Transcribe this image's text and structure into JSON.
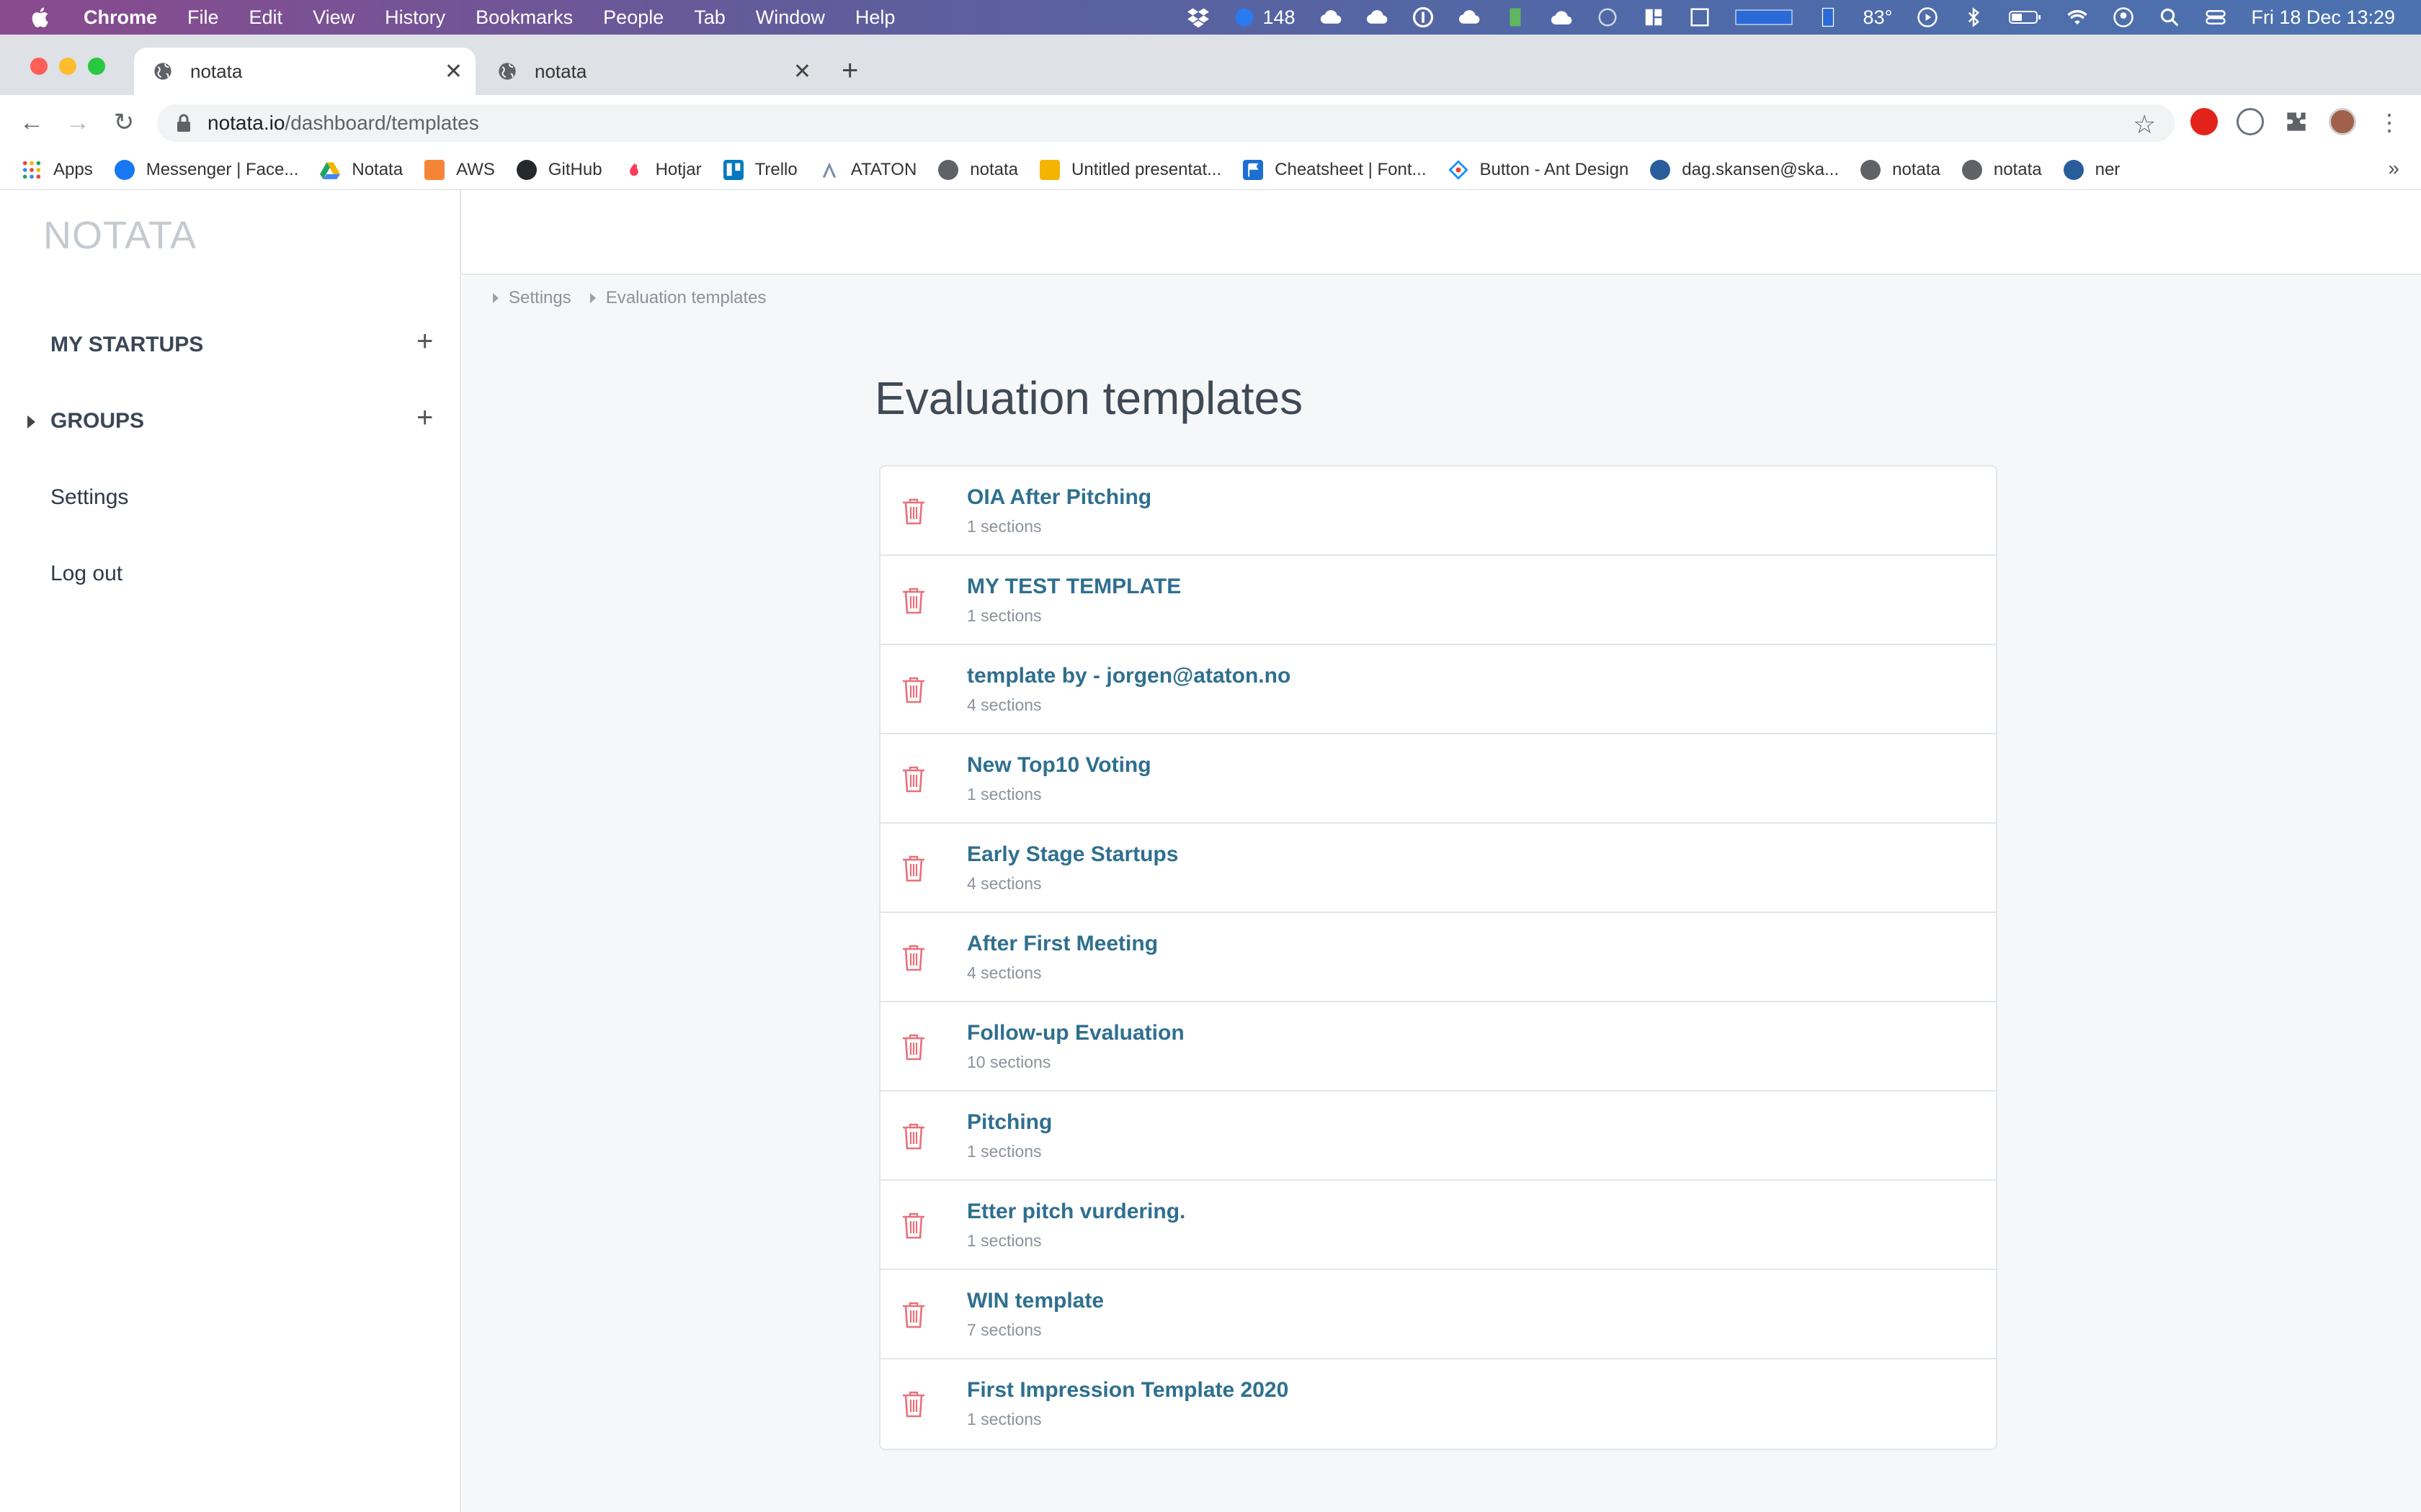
{
  "menubar": {
    "app": "Chrome",
    "items": [
      "File",
      "Edit",
      "View",
      "History",
      "Bookmarks",
      "People",
      "Tab",
      "Window",
      "Help"
    ],
    "badge_count": "148",
    "temperature": "83°",
    "datetime": "Fri 18 Dec  13:29"
  },
  "tabs": [
    {
      "title": "notata"
    },
    {
      "title": "notata"
    }
  ],
  "omnibox": {
    "host": "notata.io",
    "path": "/dashboard/templates"
  },
  "bookmarks": [
    {
      "label": "Apps",
      "icon": "apps-grid-icon",
      "color": "#e8453c"
    },
    {
      "label": "Messenger | Face...",
      "icon": "facebook-icon",
      "color": "#1877f2"
    },
    {
      "label": "Notata",
      "icon": "drive-icon",
      "color": "#1fa463"
    },
    {
      "label": "AWS",
      "icon": "aws-cube-icon",
      "color": "#f58536"
    },
    {
      "label": "GitHub",
      "icon": "github-icon",
      "color": "#24292e"
    },
    {
      "label": "Hotjar",
      "icon": "hotjar-flame-icon",
      "color": "#fd3a5c"
    },
    {
      "label": "Trello",
      "icon": "trello-icon",
      "color": "#0079bf"
    },
    {
      "label": "ATATON",
      "icon": "ataton-icon",
      "color": "#7a8ca5"
    },
    {
      "label": "notata",
      "icon": "globe-icon",
      "color": "#5f6368"
    },
    {
      "label": "Untitled presentat...",
      "icon": "slides-icon",
      "color": "#f4b400"
    },
    {
      "label": "Cheatsheet | Font...",
      "icon": "flag-icon",
      "color": "#1c6fd1"
    },
    {
      "label": "Button - Ant Design",
      "icon": "ant-design-icon",
      "color": "#f04134"
    },
    {
      "label": "dag.skansen@ska...",
      "icon": "database-icon",
      "color": "#2a5d9c"
    },
    {
      "label": "notata",
      "icon": "globe-icon",
      "color": "#5f6368"
    },
    {
      "label": "notata",
      "icon": "globe-icon",
      "color": "#5f6368"
    },
    {
      "label": "ner",
      "icon": "database-icon",
      "color": "#2a5d9c"
    }
  ],
  "app": {
    "logo": "NOTATA",
    "sidebar": {
      "my_startups": "MY STARTUPS",
      "groups": "GROUPS",
      "settings": "Settings",
      "logout": "Log out"
    },
    "breadcrumb": [
      "Settings",
      "Evaluation templates"
    ],
    "title": "Evaluation templates",
    "templates": [
      {
        "name": "OIA After Pitching",
        "sections": "1 sections"
      },
      {
        "name": "MY TEST TEMPLATE",
        "sections": "1 sections"
      },
      {
        "name": "template by - jorgen@ataton.no",
        "sections": "4 sections"
      },
      {
        "name": "New Top10 Voting",
        "sections": "1 sections"
      },
      {
        "name": "Early Stage Startups",
        "sections": "4 sections"
      },
      {
        "name": "After First Meeting",
        "sections": "4 sections"
      },
      {
        "name": "Follow-up Evaluation",
        "sections": "10 sections"
      },
      {
        "name": "Pitching",
        "sections": "1 sections"
      },
      {
        "name": "Etter pitch vurdering.",
        "sections": "1 sections"
      },
      {
        "name": "WIN template",
        "sections": "7 sections"
      },
      {
        "name": "First Impression Template 2020",
        "sections": "1 sections"
      }
    ],
    "colors": {
      "link": "#2f6f8f",
      "trash": "#e8707a",
      "accent": "#c5cad0"
    }
  }
}
